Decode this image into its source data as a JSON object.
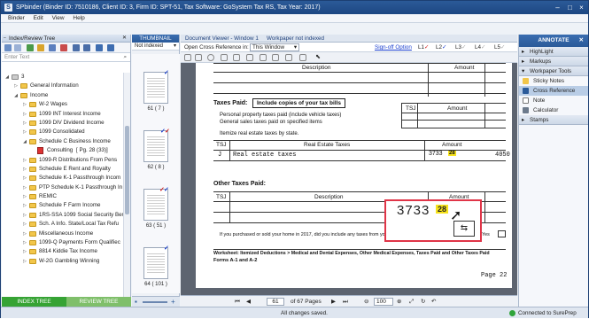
{
  "titlebar": {
    "title": "SPbinder (Binder ID: 7510186, Client ID: 3, Firm ID: SPT-51, Tax Software: GoSystem Tax RS, Tax Year: 2017)"
  },
  "menubar": {
    "items": [
      "Binder",
      "Edit",
      "View",
      "Help"
    ]
  },
  "left": {
    "header": "Index/Review Tree",
    "search_placeholder": "Enter Text",
    "tree": [
      {
        "label": "3",
        "level": 0
      },
      {
        "label": "General Information",
        "level": 1
      },
      {
        "label": "Income",
        "level": 1
      },
      {
        "label": "W-2 Wages",
        "level": 2
      },
      {
        "label": "1099 INT Interest Income",
        "level": 2
      },
      {
        "label": "1099 DIV Dividend Income",
        "level": 2
      },
      {
        "label": "1099 Consolidated",
        "level": 2
      },
      {
        "label": "Schedule C Business Income",
        "level": 2
      },
      {
        "label": "Consulting",
        "page": "[ Pg. 28 (33)]",
        "level": 3
      },
      {
        "label": "1099-R Distributions From Pens",
        "level": 2
      },
      {
        "label": "Schedule E Rent and Royalty",
        "level": 2
      },
      {
        "label": "Schedule K-1 Passthrough Incom",
        "level": 2
      },
      {
        "label": "PTP Schedule K-1 Passthrough In",
        "level": 2
      },
      {
        "label": "REMIC",
        "level": 2
      },
      {
        "label": "Schedule F Farm Income",
        "level": 2
      },
      {
        "label": "1RS-SSA 1099 Social Security Ber",
        "level": 2
      },
      {
        "label": "Sch. A Info. State/Local Tax Refu",
        "level": 2
      },
      {
        "label": "Miscellaneous Income",
        "level": 2
      },
      {
        "label": "1099-Q Payments Form Qualifiec",
        "level": 2
      },
      {
        "label": "8814 Kiddie Tax Income",
        "level": 2
      },
      {
        "label": "W-2G Gambling Winning",
        "level": 2
      }
    ],
    "tabs": [
      "INDEX TREE",
      "REVIEW TREE"
    ]
  },
  "thumbs": {
    "header": "THUMBNAIL",
    "filter": "Not indexed",
    "pages": [
      "61 ( 7 )",
      "62 ( 8 )",
      "63 ( 51 )",
      "64 ( 101 )"
    ]
  },
  "doc": {
    "tab": "Document Viewer - Window 1",
    "tab_status": "Workpaper not indexed",
    "open_label": "Open Cross Reference in:",
    "open_value": "This Window",
    "signoff": "Sign-off Option",
    "levels": [
      "L1",
      "L2",
      "L3",
      "L4",
      "L5"
    ],
    "form": {
      "desc_header": "Description",
      "amount_header": "Amount",
      "taxes_paid": "Taxes Paid:",
      "taxes_note": "Include copies of your tax bills",
      "tsj": "TSJ",
      "personal": "Personal property taxes paid (include vehicle taxes)",
      "general_sales": "General sales taxes paid on specified items",
      "itemize": "Itemize real estate taxes by state.",
      "ret_header": "Real Estate Taxes",
      "row_tsj": "J",
      "row_desc": "Real estate taxes",
      "row_handwritten": "3733",
      "row_ref": "28",
      "row_amount": "4050",
      "other": "Other Taxes Paid:",
      "question": "If you purchased or sold your home in 2017, did you include any taxes from your closing statement in the amounts above?",
      "yes": "Yes",
      "footer1": "Worksheet: Itemized Deductions > Medical and Dental Expenses, Other Medical Expenses, Taxes Paid and Other Taxes Paid",
      "footer2": "Forms A-1 and A-2",
      "page": "Page 22"
    },
    "page_current": "61",
    "page_total": "of  67 Pages",
    "zoom": "100"
  },
  "right": {
    "button": "ANNOTATE",
    "sections": [
      {
        "label": "HighLight",
        "items": []
      },
      {
        "label": "Markups",
        "items": []
      },
      {
        "label": "Workpaper Tools",
        "items": [
          "Sticky Notes",
          "Cross Reference",
          "Note",
          "Calculator"
        ]
      },
      {
        "label": "Stamps",
        "items": []
      }
    ]
  },
  "status": {
    "center": "All changes saved.",
    "right": "Connected to SurePrep"
  }
}
